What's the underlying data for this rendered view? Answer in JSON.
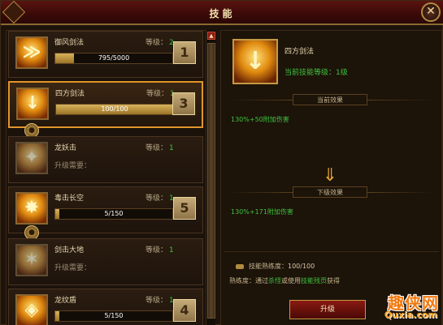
{
  "window": {
    "title": "技能",
    "close_label": "✕"
  },
  "skills": [
    {
      "name": "御风剑法",
      "level_label": "等级：",
      "level": "2",
      "progress_text": "795/5000",
      "progress": 0.159,
      "hotkey": "1",
      "glyph": "≫"
    },
    {
      "name": "四方剑法",
      "level_label": "等级：",
      "level": "1",
      "progress_text": "100/100",
      "progress": 1.0,
      "hotkey": "3",
      "glyph": "↓",
      "selected": true
    },
    {
      "name": "龙妖击",
      "level_label": "等级：",
      "level": "1",
      "requirement": "升级需要：",
      "glyph": "✦"
    },
    {
      "name": "毒击长空",
      "level_label": "等级：",
      "level": "1",
      "progress_text": "5/150",
      "progress": 0.033,
      "hotkey": "5",
      "glyph": "✸"
    },
    {
      "name": "剑击大地",
      "level_label": "等级：",
      "level": "1",
      "requirement": "升级需要：",
      "glyph": "✶"
    },
    {
      "name": "龙纹盾",
      "level_label": "等级：",
      "level": "1",
      "progress_text": "5/150",
      "progress": 0.033,
      "hotkey": "4",
      "glyph": "◈"
    }
  ],
  "detail": {
    "name": "四方剑法",
    "current_level": "当前技能等级：1级",
    "current_effect_header": "当前效果",
    "current_effect": "130%+50附加伤害",
    "next_effect_header": "下级效果",
    "next_effect": "130%+171附加伤害",
    "proficiency_label": "技能熟练度：",
    "proficiency_value": "100/100",
    "prof_desc_a": "熟练度：通过",
    "prof_desc_kill": "杀怪",
    "prof_desc_b": "或使用",
    "prof_desc_book": "技能残页",
    "prof_desc_c": "获得",
    "upgrade_label": "升级",
    "arrow": "⇓"
  },
  "watermark": {
    "title": "趣侠网",
    "sub": "Quxia.com"
  },
  "scroll": {
    "up": "▲"
  }
}
